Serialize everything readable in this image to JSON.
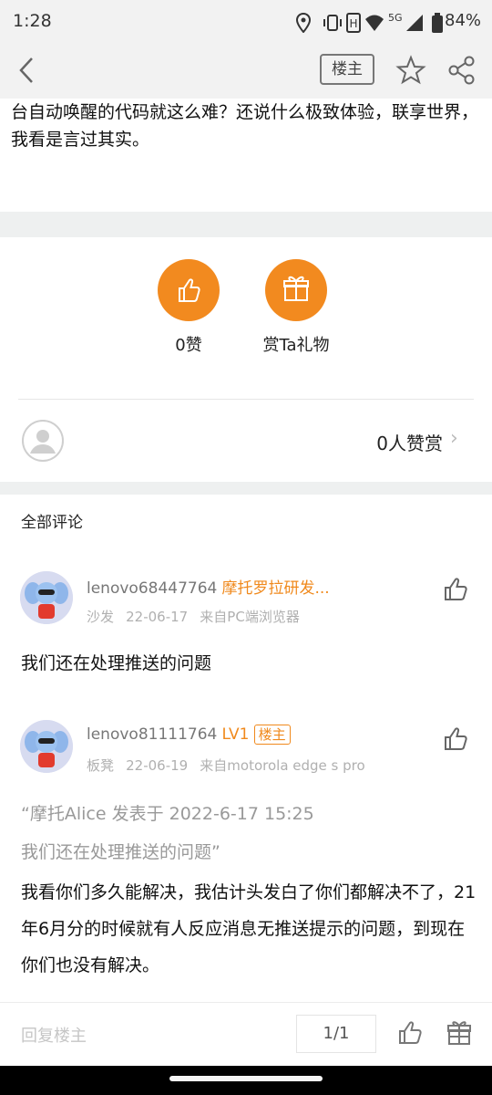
{
  "status_bar": {
    "time": "1:28",
    "battery": "84%",
    "network": "5G"
  },
  "nav": {
    "owner_button": "楼主"
  },
  "post": {
    "text": "台自动唤醒的代码就这么难？还说什么极致体验，联享世界，我看是言过其实。"
  },
  "actions": {
    "like_label": "0赞",
    "gift_label": "赏Ta礼物"
  },
  "reward": {
    "count_label": "0人赞赏"
  },
  "comments_header": "全部评论",
  "comments": [
    {
      "username": "lenovo68447764",
      "rank": "摩托罗拉研发...",
      "floor": "沙发",
      "date": "22-06-17",
      "source": "来自PC端浏览器",
      "text": "我们还在处理推送的问题"
    },
    {
      "username": "lenovo81111764",
      "rank": "LV1",
      "tag": "楼主",
      "floor": "板凳",
      "date": "22-06-19",
      "source": "来自motorola edge s pro",
      "quote_line1": "“摩托Alice 发表于 2022-6-17 15:25",
      "quote_line2": "我们还在处理推送的问题”",
      "text": "我看你们多久能解决，我估计头发白了你们都解决不了，21年6月分的时候就有人反应消息无推送提示的问题，到现在你们也没有解决。"
    }
  ],
  "bottom_bar": {
    "reply_placeholder": "回复楼主",
    "page": "1/1"
  },
  "colors": {
    "accent": "#f28a1f",
    "nav_bg": "#f2f2f2",
    "gap_bg": "#eef0f0"
  }
}
